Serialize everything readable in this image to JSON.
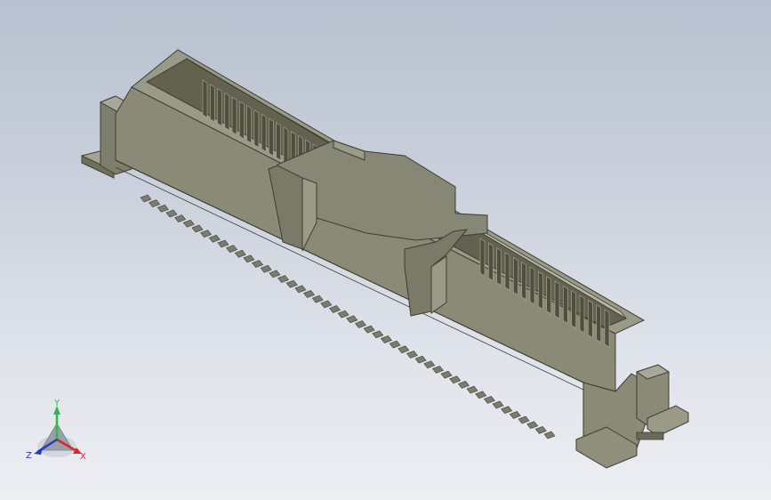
{
  "viewport": {
    "background_top": "#b7c1cf",
    "background_bottom": "#eceef2"
  },
  "model": {
    "type": "board-to-board connector",
    "body_color": "#8f8f7a",
    "pin_color": "#7c7c6e",
    "contacts_visible_per_side": 16,
    "leads_visible": 48
  },
  "triad": {
    "y_label": "Y",
    "x_label": "X",
    "z_label": "Z",
    "y_color": "#2fb84a",
    "x_color": "#d8262a",
    "z_color": "#2438c9"
  }
}
